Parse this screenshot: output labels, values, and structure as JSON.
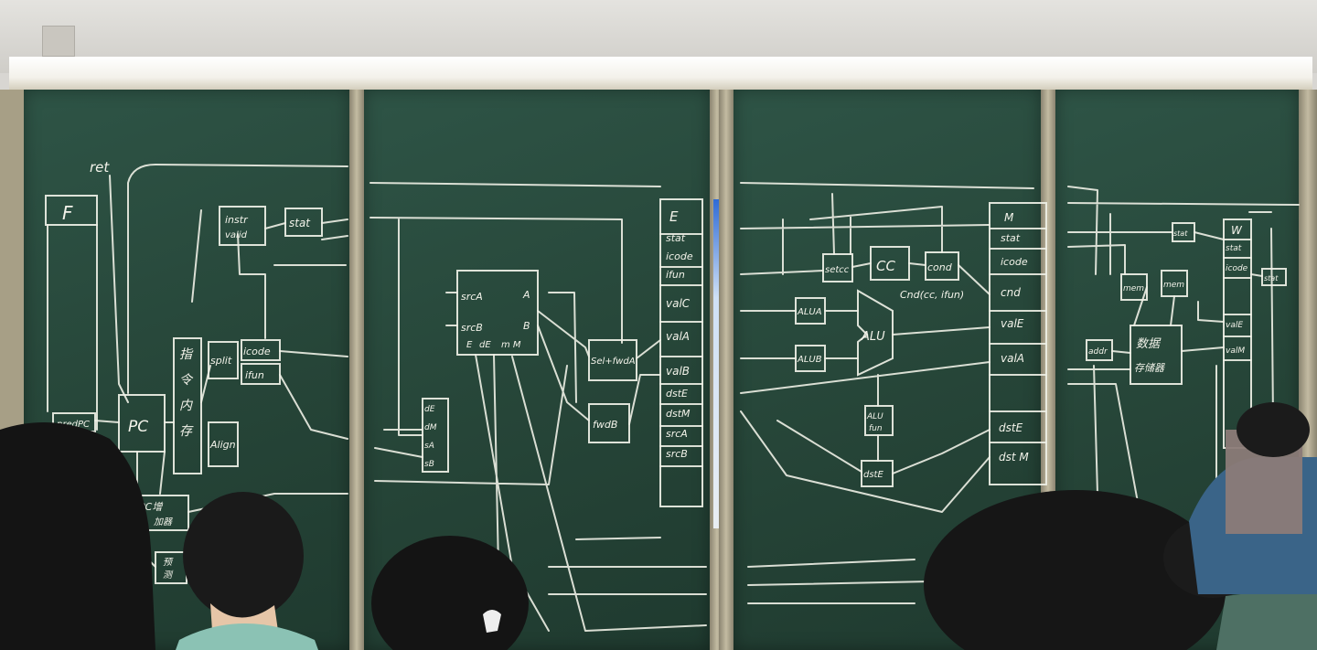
{
  "colors": {
    "board": "#2b4d40",
    "chalk": "#eef0e6",
    "frame": "#a79f86"
  },
  "board1": {
    "ret": "ret",
    "F": "F",
    "instr": "instr",
    "valid": "valid",
    "stat": "stat",
    "fetch_char1": "指",
    "fetch_char2": "令",
    "fetch_char3": "内",
    "fetch_char4": "存",
    "split": "split",
    "icode": "icode",
    "ifun": "ifun",
    "align": "Align",
    "pc": "PC",
    "predpc": "predPC",
    "pcinc1": "PC增",
    "pcinc2": "加器",
    "pred1": "预",
    "pred2": "测"
  },
  "board2": {
    "E": "E",
    "stat": "stat",
    "icode": "icode",
    "ifun": "ifun",
    "valC": "valC",
    "valA": "valA",
    "valB": "valB",
    "dstE": "dstE",
    "dstM": "dstM",
    "srcA": "srcA",
    "srcB": "srcB",
    "rf_srcA": "srcA",
    "rf_A": "A",
    "rf_srcB": "srcB",
    "rf_B": "B",
    "rf_E": "E",
    "rf_dE": "dE",
    "rf_mM": "m M",
    "sel_fwdA": "Sel+fwdA",
    "fwdB": "fwdB",
    "d_dE": "dE",
    "d_dM": "dM",
    "d_sA": "sA",
    "d_sB": "sB"
  },
  "board3": {
    "M": "M",
    "stat": "stat",
    "icode": "icode",
    "cnd": "cnd",
    "valE": "valE",
    "valA": "valA",
    "dstE": "dstE",
    "dstM": "dst M",
    "setcc": "setcc",
    "cc": "CC",
    "cond": "cond",
    "cond_expr": "Cnd(cc, ifun)",
    "aluA": "ALUA",
    "aluB": "ALUB",
    "alu": "ALU",
    "alu_fun1": "ALU",
    "alu_fun2": "fun",
    "dstE_box": "dstE"
  },
  "board4": {
    "W": "W",
    "stat": "stat",
    "icode": "icode",
    "valE": "valE",
    "valM": "valM",
    "stat_box": "stat",
    "mem_read": "mem",
    "mem_write": "mem",
    "addr": "addr",
    "dmem1": "数据",
    "dmem2": "存储器",
    "stat_out": "stat"
  }
}
